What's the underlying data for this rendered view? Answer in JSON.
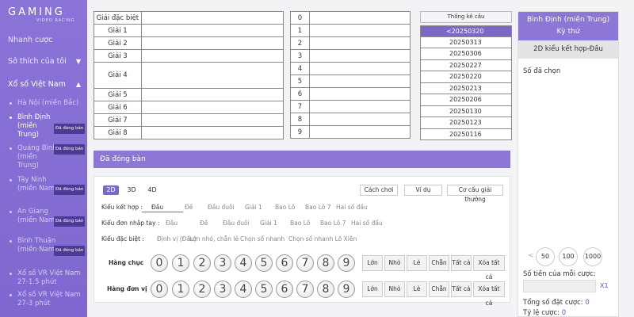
{
  "brand": {
    "name": "GAMING",
    "sub": "VIDEO RACING"
  },
  "sidebar": {
    "items": [
      {
        "label": "Nhanh cược"
      },
      {
        "label": "Sở thích của tôi"
      },
      {
        "label": "Xổ số Việt Nam"
      }
    ],
    "lottery": [
      {
        "label": "Hà Nội (miền Bắc)",
        "badge": ""
      },
      {
        "label": "Bình Định (miền Trung)",
        "badge": "Đã đóng bán"
      },
      {
        "label": "Quảng Bình (miền Trung)",
        "badge": "Đã đóng bán"
      },
      {
        "label": "Tây Ninh (miền Nam)",
        "badge": "Đã đóng bán"
      },
      {
        "label": "An Giang (miền Nam)",
        "badge": "Đã đóng bán"
      },
      {
        "label": "Bình Thuận (miền Nam)",
        "badge": "Đã đóng bán"
      },
      {
        "label": "Xổ số VR Việt Nam 27-1.5 phút",
        "badge": ""
      },
      {
        "label": "Xổ số VR Việt Nam 27-3 phút",
        "badge": ""
      }
    ]
  },
  "prizes": [
    "Giải đặc biệt",
    "Giải 1",
    "Giải 2",
    "Giải 3",
    "Giải 4",
    "Giải 5",
    "Giải 6",
    "Giải 7",
    "Giải 8"
  ],
  "digits_table": [
    "0",
    "1",
    "2",
    "3",
    "4",
    "5",
    "6",
    "7",
    "8",
    "9"
  ],
  "stats": {
    "title": "Thống kê cầu",
    "dates": [
      "<20250320",
      "20250313",
      "20250306",
      "20250227",
      "20250220",
      "20250213",
      "20250206",
      "20250130",
      "20250123",
      "20250116"
    ]
  },
  "bet": {
    "closed_label": "Đã đóng bàn",
    "tabs": [
      "2D",
      "3D",
      "4D"
    ],
    "actions": [
      "Cách chơi",
      "Ví dụ",
      "Cơ cấu giải thưởng"
    ],
    "rows": [
      {
        "label": "Kiểu kết hợp :",
        "options": [
          "Đầu",
          "Đề",
          "Đầu đuôi",
          "Giải 1",
          "Bao Lô",
          "Bao Lô 7",
          "Hai số đầu"
        ]
      },
      {
        "label": "Kiểu đơn nhập tay :",
        "options": [
          "Đầu",
          "Đề",
          "Đầu đuôi",
          "Giải 1",
          "Bao Lô",
          "Bao Lô 7",
          "Hai số đầu"
        ]
      },
      {
        "label": "Kiểu đặc biệt :",
        "options": [
          "Định vị (Đầu)",
          "Lớn nhỏ, chẵn lẻ",
          "Chọn số nhanh",
          "Chọn số nhanh Lô Xiên"
        ]
      }
    ],
    "digit_rows": [
      "Hàng chục",
      "Hàng đơn vị"
    ],
    "balls": [
      "0",
      "1",
      "2",
      "3",
      "4",
      "5",
      "6",
      "7",
      "8",
      "9"
    ],
    "quick": [
      "Lớn",
      "Nhỏ",
      "Lẻ",
      "Chẵn",
      "Tất cả",
      "Xóa tất cả"
    ]
  },
  "right": {
    "title": "Bình Định (miền Trung)",
    "subtitle": "Kỳ thứ",
    "tab": "2D kiểu kết hợp-Đầu",
    "selected_label": "Số đã chọn",
    "chips": [
      "50",
      "100",
      "1000"
    ],
    "amount_label": "Số tiền của mỗi cược:",
    "multiplier": "X1",
    "total_label": "Tổng số đặt cược:",
    "total_value": "0",
    "rate_label": "Tỷ lệ cược:",
    "rate_value": "0"
  }
}
